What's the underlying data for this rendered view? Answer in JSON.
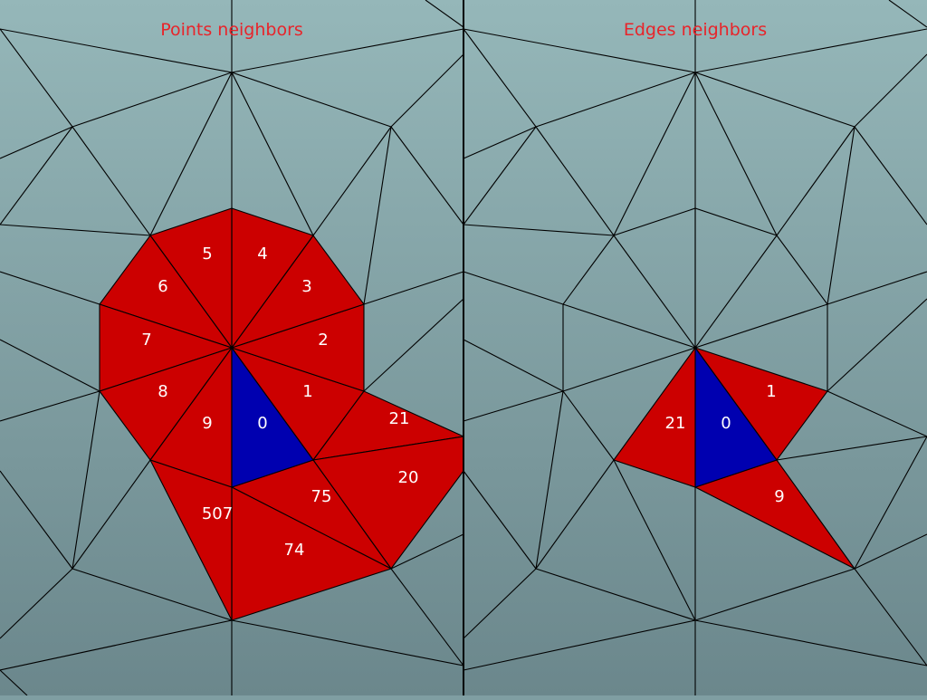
{
  "colors": {
    "background_top": "#95b7b9",
    "background_bottom": "#6b878c",
    "neighbor_fill": "#cc0000",
    "selected_fill": "#0000b0",
    "title_text": "#e8242a",
    "label_text": "#ffffff",
    "mesh_line": "#000000"
  },
  "panels": [
    {
      "title": "Points neighbors",
      "selected_label": "0",
      "neighbor_labels": [
        "1",
        "2",
        "3",
        "4",
        "5",
        "6",
        "7",
        "8",
        "9",
        "21",
        "20",
        "75",
        "74",
        "507"
      ]
    },
    {
      "title": "Edges neighbors",
      "selected_label": "0",
      "neighbor_labels": [
        "1",
        "21",
        "9"
      ]
    }
  ]
}
